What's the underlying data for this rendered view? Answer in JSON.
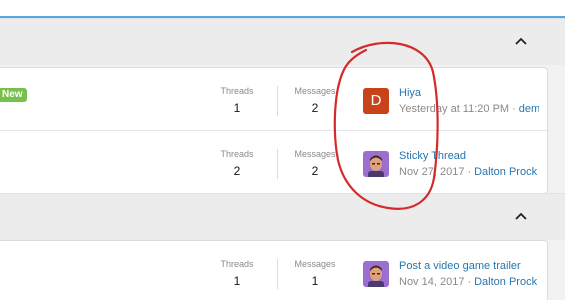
{
  "sections": [
    {
      "forums": [
        {
          "badge": "New",
          "threads_label": "Threads",
          "threads": "1",
          "messages_label": "Messages",
          "messages": "2",
          "avatar": {
            "type": "letter",
            "letter": "D",
            "color": "#c9431a"
          },
          "last_title": "Hiya",
          "last_date": "Yesterday at 11:20 PM",
          "separator": "·",
          "last_user": "demo"
        },
        {
          "threads_label": "Threads",
          "threads": "2",
          "messages_label": "Messages",
          "messages": "2",
          "avatar": {
            "type": "photo",
            "icon": "user-avatar-photo"
          },
          "last_title": "Sticky Thread",
          "last_date": "Nov 27, 2017",
          "separator": "·",
          "last_user": "Dalton Prock"
        }
      ]
    },
    {
      "forums": [
        {
          "threads_label": "Threads",
          "threads": "1",
          "messages_label": "Messages",
          "messages": "1",
          "avatar": {
            "type": "photo",
            "icon": "user-avatar-photo"
          },
          "last_title": "Post a video game trailer",
          "last_date": "Nov 14, 2017",
          "separator": "·",
          "last_user": "Dalton Prock"
        }
      ]
    }
  ],
  "colors": {
    "accent": "#5aa6de",
    "link": "#2577b1",
    "badge_new": "#77c04b",
    "annotation": "#d42a2a"
  },
  "icons": {
    "collapse": "chevron-up-icon"
  }
}
